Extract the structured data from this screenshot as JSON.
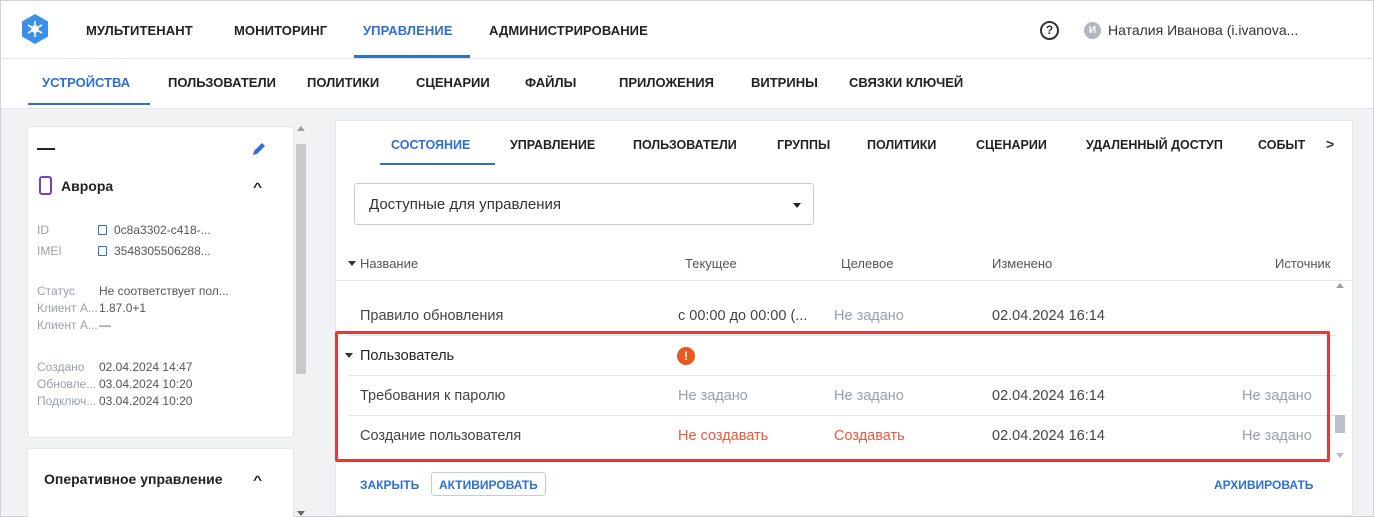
{
  "user": {
    "avatar_letter": "И",
    "name": "Наталия Иванова (i.ivanova..."
  },
  "top_nav": [
    "МУЛЬТИТЕНАНТ",
    "МОНИТОРИНГ",
    "УПРАВЛЕНИЕ",
    "АДМИНИСТРИРОВАНИЕ"
  ],
  "top_nav_active": "УПРАВЛЕНИЕ",
  "help_icon_glyph": "?",
  "sub_nav": [
    "УСТРОЙСТВА",
    "ПОЛЬЗОВАТЕЛИ",
    "ПОЛИТИКИ",
    "СЦЕНАРИИ",
    "ФАЙЛЫ",
    "ПРИЛОЖЕНИЯ",
    "ВИТРИНЫ",
    "СВЯЗКИ КЛЮЧЕЙ"
  ],
  "sub_nav_active": "УСТРОЙСТВА",
  "device": {
    "title": "—",
    "os_name": "Аврора",
    "info": [
      {
        "key": "ID",
        "value": "0c8a3302-c418-..."
      },
      {
        "key": "IMEI",
        "value": "3548305506288..."
      },
      {
        "key": "Статус",
        "value": "Не соответствует пол..."
      },
      {
        "key": "Клиент А...",
        "value": "1.87.0+1"
      },
      {
        "key": "Клиент А...",
        "value": "—"
      },
      {
        "key": "Создано",
        "value": "02.04.2024 14:47"
      },
      {
        "key": "Обновле...",
        "value": "03.04.2024 10:20"
      },
      {
        "key": "Подключ...",
        "value": "03.04.2024 10:20"
      }
    ]
  },
  "operational": {
    "title": "Оперативное управление"
  },
  "detail_tabs": [
    "СОСТОЯНИЕ",
    "УПРАВЛЕНИЕ",
    "ПОЛЬЗОВАТЕЛИ",
    "ГРУППЫ",
    "ПОЛИТИКИ",
    "СЦЕНАРИИ",
    "УДАЛЕННЫЙ ДОСТУП",
    "СОБЫТ"
  ],
  "detail_tab_active": "СОСТОЯНИЕ",
  "filter": {
    "value": "Доступные для управления"
  },
  "table": {
    "columns": [
      "Название",
      "Текущее",
      "Целевое",
      "Изменено",
      "Источник"
    ],
    "rows": [
      {
        "name": "Правило обновления",
        "current": "с 00:00 до 00:00 (...",
        "target": "Не задано",
        "changed": "02.04.2024 16:14",
        "source": ""
      },
      {
        "group": true,
        "name": "Пользователь",
        "alert": "!"
      },
      {
        "name": "Требования к паролю",
        "current": "Не задано",
        "target": "Не задано",
        "changed": "02.04.2024 16:14",
        "source": "Не задано"
      },
      {
        "name": "Создание пользователя",
        "current": "Не создавать",
        "target": "Создавать",
        "changed": "02.04.2024 16:14",
        "source": "Не задано"
      }
    ]
  },
  "actions": {
    "close": "ЗАКРЫТЬ",
    "activate": "АКТИВИРОВАТЬ",
    "archive": "АРХИВИРОВАТЬ"
  },
  "colors": {
    "accent": "#2f6fd1",
    "warning": "#e9573f",
    "highlight": "#e53935"
  }
}
